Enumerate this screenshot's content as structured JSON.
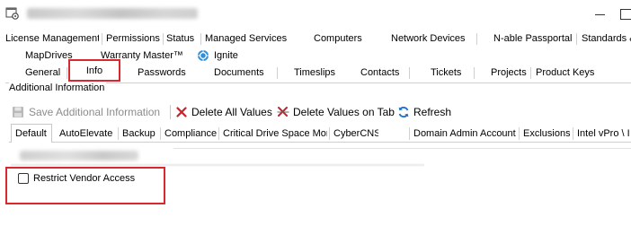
{
  "tabs_row1": [
    "License Management",
    "Permissions",
    "Status",
    "Managed Services",
    "Computers",
    "Network Devices",
    "N-able Passportal",
    "Standards &"
  ],
  "tabs_row2": [
    "MapDrives",
    "Warranty Master™",
    "Ignite"
  ],
  "tabs_row3": [
    "General",
    "Info",
    "Passwords",
    "Documents",
    "Timeslips",
    "Contacts",
    "Tickets",
    "Projects",
    "Product Keys"
  ],
  "group": {
    "title": "Additional Information"
  },
  "toolbar": {
    "save_label": "Save Additional Information",
    "delete_all_label": "Delete All Values",
    "delete_tab_label": "Delete Values on Tab",
    "refresh_label": "Refresh"
  },
  "subtabs": [
    "Default",
    "AutoElevate",
    "Backup",
    "Compliance",
    "Critical Drive Space Monitorin",
    "CyberCNS",
    "Domain Admin Account",
    "Exclusions",
    "Intel vPro \\ I"
  ],
  "fields": {
    "restrict_vendor_label": "Restrict Vendor Access"
  },
  "colors": {
    "highlight": "#d9272e",
    "delete_red": "#c8232c",
    "refresh_blue": "#1e6fd0",
    "ignite_blue": "#2f8fd8"
  },
  "icons": {
    "app": "gear-window-icon",
    "save": "floppy-disk-icon",
    "delete_all": "red-x-icon",
    "delete_tab": "red-x-strike-icon",
    "refresh": "refresh-arrows-icon",
    "ignite": "ignite-globe-icon"
  }
}
